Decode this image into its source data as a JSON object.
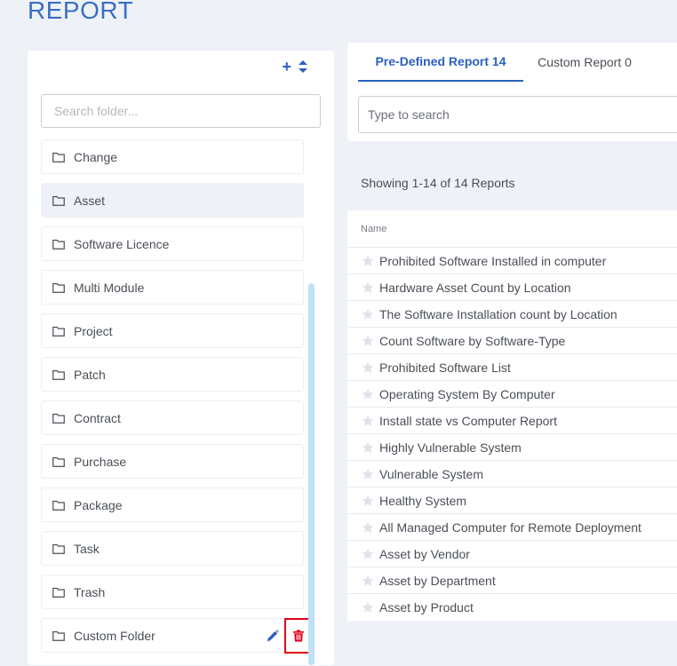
{
  "page": {
    "title": "REPORT"
  },
  "folders": {
    "search_placeholder": "Search folder...",
    "items": [
      {
        "label": "Change"
      },
      {
        "label": "Asset"
      },
      {
        "label": "Software Licence"
      },
      {
        "label": "Multi Module"
      },
      {
        "label": "Project"
      },
      {
        "label": "Patch"
      },
      {
        "label": "Contract"
      },
      {
        "label": "Purchase"
      },
      {
        "label": "Package"
      },
      {
        "label": "Task"
      },
      {
        "label": "Trash"
      },
      {
        "label": "Custom Folder"
      }
    ],
    "active_item": "Asset"
  },
  "tabs": [
    {
      "label": "Pre-Defined Report 14"
    },
    {
      "label": "Custom Report 0"
    }
  ],
  "report_search": {
    "placeholder": "Type to search"
  },
  "showing": "Showing 1-14 of 14 Reports",
  "table": {
    "column_name": "Name",
    "rows": [
      "Prohibited Software Installed in computer",
      "Hardware Asset Count by Location",
      "The Software Installation count by Location",
      "Count Software by Software-Type",
      "Prohibited Software List",
      "Operating System By Computer",
      "Install state vs Computer Report",
      "Highly Vulnerable System",
      "Vulnerable System",
      "Healthy System",
      "All Managed Computer for Remote Deployment",
      "Asset by Vendor",
      "Asset by Department",
      "Asset by Product"
    ]
  },
  "colors": {
    "accent": "#2b5fbf",
    "title": "#3a6fc4",
    "delete_highlight": "#e2001a",
    "scrollbar": "#bfe0f7"
  }
}
